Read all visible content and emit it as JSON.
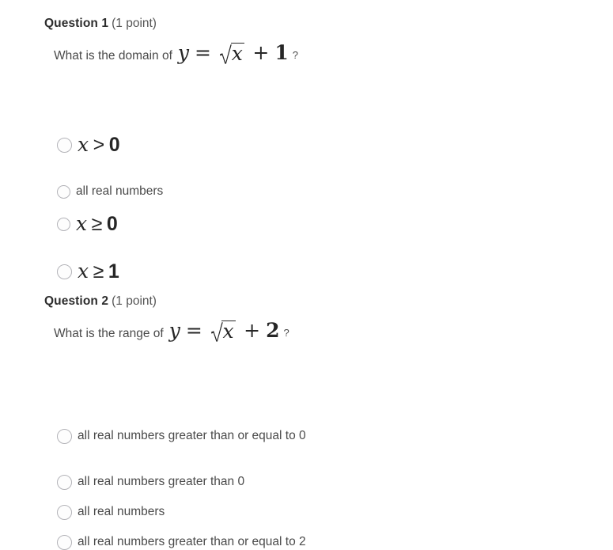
{
  "page": {
    "background_color": "#ffffff",
    "text_color": "#4a4a4a",
    "heading_color": "#2d2d2d",
    "radio_border_color": "#b3b3b8"
  },
  "questions": [
    {
      "id": "question-1",
      "title": "Question 1",
      "points": "(1 point)",
      "stem_prefix": "What is the domain of",
      "stem_suffix": "?",
      "formula": {
        "lhs_var": "y",
        "equals": "=",
        "radical_symbol": "√",
        "radicand": "x",
        "plus": "+",
        "addend": "1",
        "plain_text": "y = √x + 1"
      },
      "options": [
        {
          "key": "q1-option-1",
          "label": "x > 0",
          "is_math": true,
          "math": {
            "var": "x",
            "rel": ">",
            "num": "0"
          }
        },
        {
          "key": "q1-option-2",
          "label": "all real numbers",
          "is_math": false
        },
        {
          "key": "q1-option-3",
          "label": "x ≥ 0",
          "is_math": true,
          "math": {
            "var": "x",
            "rel": "≥",
            "num": "0"
          }
        },
        {
          "key": "q1-option-4",
          "label": "x ≥ 1",
          "is_math": true,
          "math": {
            "var": "x",
            "rel": "≥",
            "num": "1"
          }
        }
      ]
    },
    {
      "id": "question-2",
      "title": "Question 2",
      "points": "(1 point)",
      "stem_prefix": "What is the range of",
      "stem_suffix": "?",
      "formula": {
        "lhs_var": "y",
        "equals": "=",
        "radical_symbol": "√",
        "radicand": "x",
        "plus": "+",
        "addend": "2",
        "plain_text": "y = √x + 2"
      },
      "options": [
        {
          "key": "q2-option-1",
          "label": "all real numbers greater than or equal to 0",
          "is_math": false
        },
        {
          "key": "q2-option-2",
          "label": "all real numbers greater than 0",
          "is_math": false
        },
        {
          "key": "q2-option-3",
          "label": "all real numbers",
          "is_math": false
        },
        {
          "key": "q2-option-4",
          "label": "all real numbers greater than or equal to 2",
          "is_math": false
        }
      ]
    }
  ]
}
